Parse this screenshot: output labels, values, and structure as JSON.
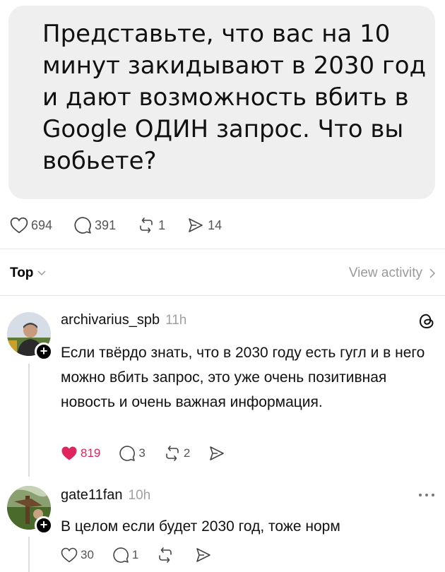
{
  "post": {
    "text": "Представьте, что вас на 10 минут закидывают в 2030 год и дают возможность вбить в Google ОДИН запрос. Что вы вобьете?"
  },
  "stats": {
    "likes": "694",
    "comments": "391",
    "reposts": "1",
    "shares": "14"
  },
  "sort": {
    "label": "Top",
    "view_activity": "View activity"
  },
  "comments": [
    {
      "username": "archivarius_spb",
      "time": "11h",
      "text": "Если твёрдо знать, что в 2030 году есть гугл и в него можно вбить запрос, это уже очень позитивная новость и очень важная информация.",
      "likes": "819",
      "replies": "3",
      "reposts": "2",
      "liked": true
    },
    {
      "username": "gate11fan",
      "time": "10h",
      "text": "В целом если будет 2030 год, тоже норм",
      "likes": "30",
      "replies": "1",
      "reposts": "",
      "liked": false
    }
  ],
  "colors": {
    "like_active": "#e0245e",
    "muted": "#9a9a9a"
  }
}
